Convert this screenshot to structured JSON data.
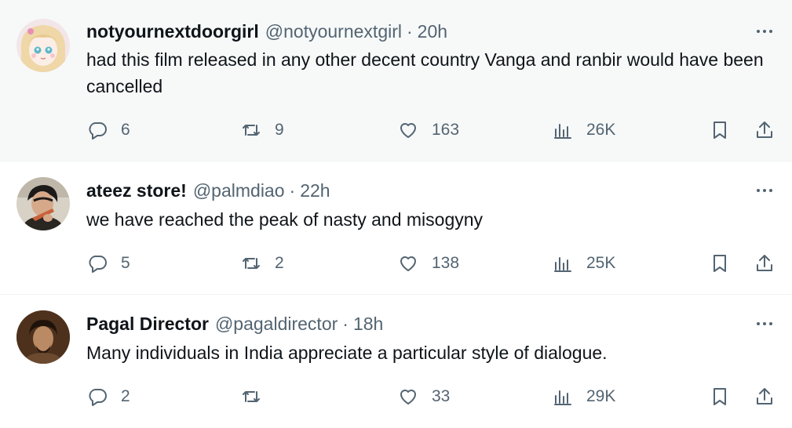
{
  "tweets": [
    {
      "name": "notyournextdoorgirl",
      "handle": "@notyournextgirl",
      "separator": "·",
      "time": "20h",
      "text": "had this film released in any other decent country Vanga and ranbir would have been cancelled",
      "replies": "6",
      "retweets": "9",
      "likes": "163",
      "views": "26K"
    },
    {
      "name": "ateez store!",
      "handle": "@palmdiao",
      "separator": "·",
      "time": "22h",
      "text": "we have reached the peak of nasty and misogyny",
      "replies": "5",
      "retweets": "2",
      "likes": "138",
      "views": "25K"
    },
    {
      "name": "Pagal Director",
      "handle": "@pagaldirector",
      "separator": "·",
      "time": "18h",
      "text": "Many individuals in India appreciate a particular style of dialogue.",
      "replies": "2",
      "retweets": "",
      "likes": "33",
      "views": "29K"
    }
  ],
  "icons": {
    "more": "more-dots-icon",
    "reply": "reply-icon",
    "retweet": "retweet-icon",
    "like": "heart-icon",
    "views": "views-icon",
    "bookmark": "bookmark-icon",
    "share": "share-icon"
  },
  "colors": {
    "text": "#0f1419",
    "secondary": "#536471",
    "hover_background": "#f7f9f9",
    "divider": "#eff3f4"
  }
}
